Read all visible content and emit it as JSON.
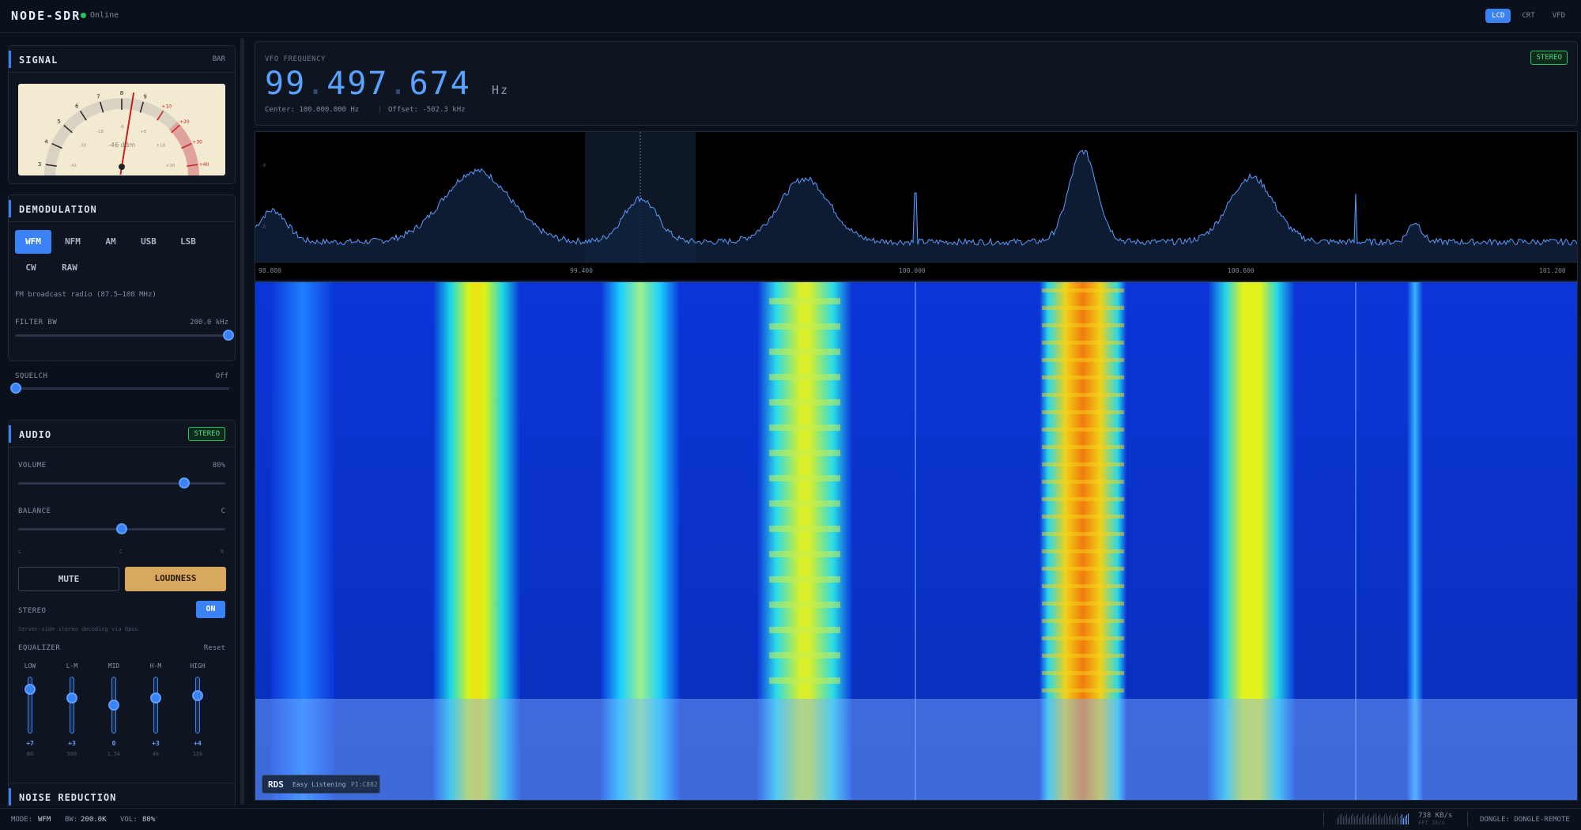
{
  "app": {
    "title": "NODE-SDR",
    "status": "Online"
  },
  "display_modes": [
    "LCD",
    "CRT",
    "VFD"
  ],
  "signal": {
    "title": "SIGNAL",
    "mode": "BAR",
    "meter_readout": "-46 dBm",
    "meter_level_dbm": -46,
    "s_scale": [
      "3",
      "4",
      "5",
      "6",
      "7",
      "8",
      "9",
      "+10",
      "+20",
      "+30",
      "+40"
    ],
    "db_scale": [
      "-42",
      "-30",
      "-18",
      "-6",
      "+6",
      "+18",
      "+30"
    ]
  },
  "demod": {
    "title": "DEMODULATION",
    "modes": [
      "WFM",
      "NFM",
      "AM",
      "USB",
      "LSB",
      "CW",
      "RAW"
    ],
    "active": "WFM",
    "description": "FM broadcast radio (87.5–108 MHz)",
    "filter_label": "FILTER BW",
    "filter_value": "200.0 kHz",
    "filter_fraction": 1.0,
    "squelch_label": "SQUELCH",
    "squelch_value": "Off",
    "squelch_fraction": 0.0
  },
  "audio": {
    "title": "AUDIO",
    "badge": "STEREO",
    "volume_label": "VOLUME",
    "volume_value": "80%",
    "volume_fraction": 0.8,
    "balance_label": "BALANCE",
    "balance_value": "C",
    "balance_fraction": 0.5,
    "balance_ticks": [
      "L",
      "C",
      "R"
    ],
    "mute_label": "MUTE",
    "loudness_label": "LOUDNESS",
    "stereo_label": "STEREO",
    "stereo_toggle": "ON",
    "stereo_note": "Server-side stereo decoding via Opus",
    "eq_label": "EQUALIZER",
    "eq_reset": "Reset",
    "eq_bands": [
      {
        "name": "LOW",
        "gain": "+7",
        "freq": "80",
        "level": 0.78
      },
      {
        "name": "L-M",
        "gain": "+3",
        "freq": "500",
        "level": 0.62
      },
      {
        "name": "MID",
        "gain": "0",
        "freq": "1.5k",
        "level": 0.5
      },
      {
        "name": "H-M",
        "gain": "+3",
        "freq": "4k",
        "level": 0.62
      },
      {
        "name": "HIGH",
        "gain": "+4",
        "freq": "12k",
        "level": 0.66
      }
    ]
  },
  "noise": {
    "title": "NOISE REDUCTION"
  },
  "vfo": {
    "label": "VFO FREQUENCY",
    "g1": "99",
    "g2": "497",
    "g3": "674",
    "unit": "Hz",
    "center": "Center: 100.000.000 Hz",
    "offset": "Offset: -502.3 kHz",
    "badge": "STEREO"
  },
  "spectrum": {
    "axis": [
      "98.800",
      "99.400",
      "100.000",
      "100.600",
      "101.200"
    ],
    "ylabels": [
      "-0",
      "-0"
    ]
  },
  "rds": {
    "tag": "RDS",
    "text": "Easy Listening",
    "pi": "PI:C882"
  },
  "status": {
    "mode_label": "MODE:",
    "mode": "WFM",
    "bw_label": "BW:",
    "bw": "200.0K",
    "vol_label": "VOL:",
    "vol": "80%",
    "rate": "738 KB/s",
    "fft": "FFT 16/s",
    "dongle": "DONGLE-REMOTE"
  },
  "colors": {
    "accent": "#3b82f6",
    "stereo_green": "#4ade80",
    "loudness": "#d9a85f"
  }
}
